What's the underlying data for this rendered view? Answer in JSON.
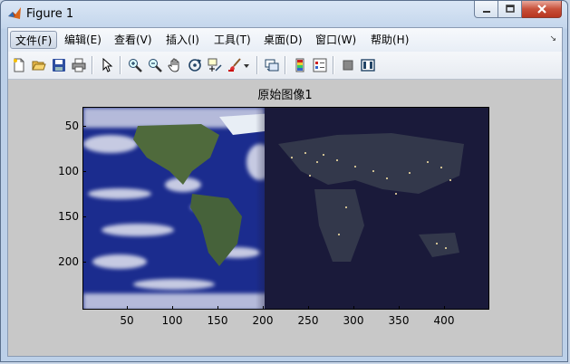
{
  "window": {
    "title": "Figure 1",
    "controls": {
      "minimize": "minimize",
      "maximize": "maximize",
      "close": "close"
    }
  },
  "menubar": {
    "items": [
      {
        "label": "文件(F)"
      },
      {
        "label": "编辑(E)"
      },
      {
        "label": "查看(V)"
      },
      {
        "label": "插入(I)"
      },
      {
        "label": "工具(T)"
      },
      {
        "label": "桌面(D)"
      },
      {
        "label": "窗口(W)"
      },
      {
        "label": "帮助(H)"
      }
    ]
  },
  "toolbar": {
    "icons": [
      "new-figure-icon",
      "open-file-icon",
      "save-icon",
      "print-icon",
      "pointer-icon",
      "zoom-in-icon",
      "zoom-out-icon",
      "pan-icon",
      "rotate-3d-icon",
      "data-cursor-icon",
      "brush-icon",
      "brush-dropdown-icon",
      "link-plot-icon",
      "colorbar-icon",
      "legend-icon",
      "hide-plot-tools-icon",
      "show-plot-tools-icon"
    ]
  },
  "axes": {
    "title": "原始图像1",
    "y_ticks": [
      "50",
      "100",
      "150",
      "200"
    ],
    "x_ticks": [
      "50",
      "100",
      "150",
      "200",
      "250",
      "300",
      "350",
      "400"
    ]
  },
  "colors": {
    "figure_background": "#c8c8c8",
    "ocean": "#1a2a8a",
    "night_overlay": "#1a1a3a"
  }
}
